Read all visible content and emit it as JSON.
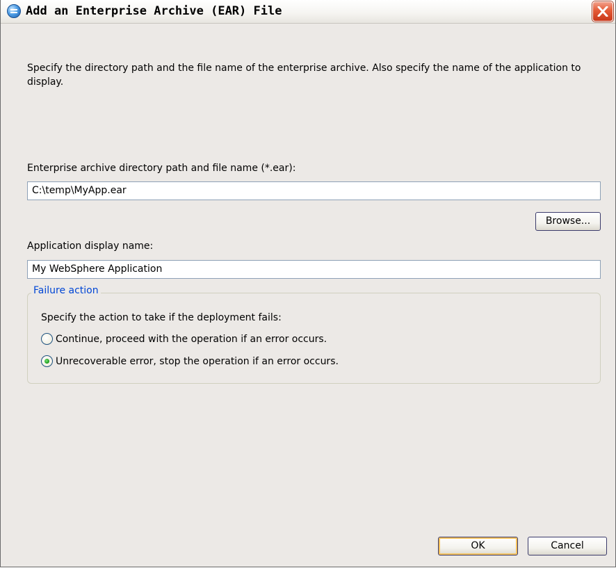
{
  "window": {
    "title": "Add an Enterprise Archive (EAR) File"
  },
  "description": "Specify the directory path and the file name of the enterprise archive. Also specify the name of the application to display.",
  "ear_path": {
    "label": "Enterprise archive directory path and file name (*.ear):",
    "value": "C:\\temp\\MyApp.ear"
  },
  "browse_button": "Browse...",
  "display_name": {
    "label": "Application display name:",
    "value": "My WebSphere Application"
  },
  "failure_action": {
    "legend": "Failure action",
    "prompt": "Specify the action to take if the deployment fails:",
    "options": [
      {
        "label": "Continue, proceed with the operation if an error occurs.",
        "selected": false
      },
      {
        "label": "Unrecoverable error, stop the operation if an error occurs.",
        "selected": true
      }
    ]
  },
  "buttons": {
    "ok": "OK",
    "cancel": "Cancel"
  },
  "icons": {
    "title": "app-globe-icon",
    "close": "close-icon"
  },
  "colors": {
    "dialog_background": "#ece9e6",
    "group_legend": "#0046d5",
    "close_button": "#e45a36"
  }
}
